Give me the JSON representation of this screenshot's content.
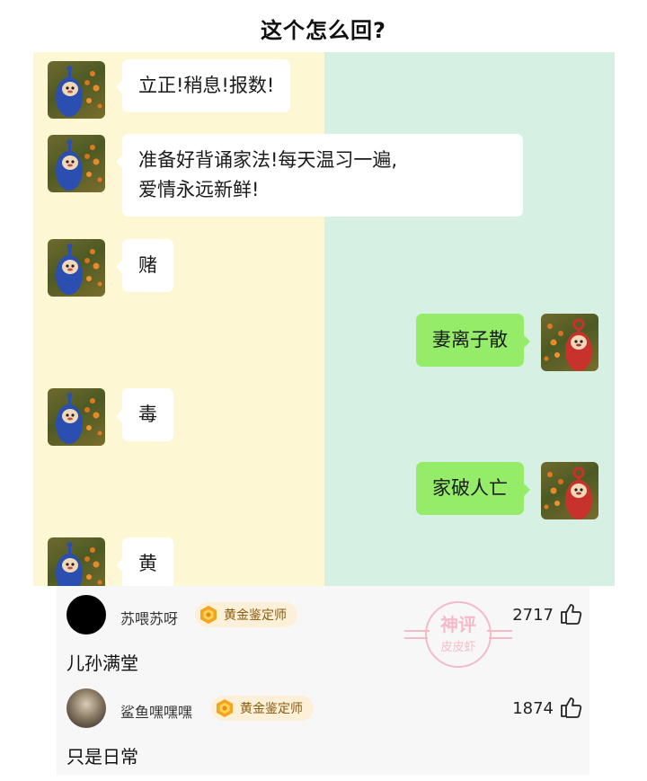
{
  "title": "这个怎么回?",
  "colors": {
    "left_bg": "#fdf8d3",
    "right_bg": "#d6f1e3",
    "bubble_left": "#ffffff",
    "bubble_right": "#95ec69",
    "badge_bg": "#fdf0d8",
    "badge_text": "#8a5a10",
    "watermark": "#f58aa6"
  },
  "chat": {
    "messages": [
      {
        "side": "left",
        "text": "立正!稍息!报数!",
        "avatar_icon": "blue-teletubby-avatar"
      },
      {
        "side": "left",
        "text": "准备好背诵家法!每天温习一遍,\n爱情永远新鲜!",
        "avatar_icon": "blue-teletubby-avatar"
      },
      {
        "side": "left",
        "text": "赌",
        "avatar_icon": "blue-teletubby-avatar"
      },
      {
        "side": "right",
        "text": "妻离子散",
        "avatar_icon": "red-teletubby-avatar"
      },
      {
        "side": "left",
        "text": "毒",
        "avatar_icon": "blue-teletubby-avatar"
      },
      {
        "side": "right",
        "text": "家破人亡",
        "avatar_icon": "red-teletubby-avatar"
      },
      {
        "side": "left",
        "text": "黄",
        "avatar_icon": "blue-teletubby-avatar"
      }
    ]
  },
  "comments": [
    {
      "username": "苏喂苏呀",
      "badge": "黄金鉴定师",
      "likes": "2717",
      "text": "儿孙满堂",
      "avatar_icon": "black-circle-avatar",
      "badge_icon": "gold-medal-icon",
      "like_icon": "thumbs-up-icon"
    },
    {
      "username": "鲨鱼嘿嘿嘿",
      "badge": "黄金鉴定师",
      "likes": "1874",
      "text": "只是日常",
      "avatar_icon": "photo-avatar",
      "badge_icon": "gold-medal-icon",
      "like_icon": "thumbs-up-icon"
    }
  ],
  "watermark": {
    "line1": "神评",
    "line2": "皮皮虾"
  }
}
